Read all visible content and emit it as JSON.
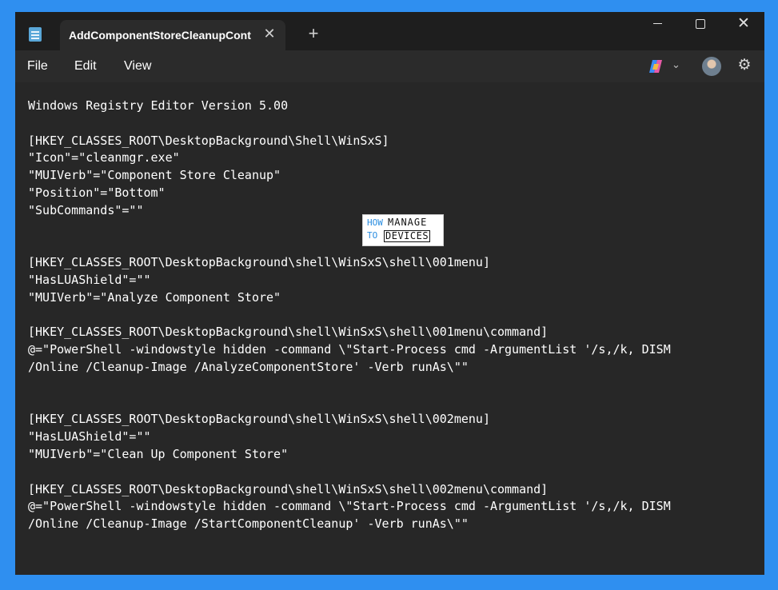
{
  "window": {
    "tab_title": "AddComponentStoreCleanupCont",
    "tab_close_glyph": "✕",
    "new_tab_glyph": "+",
    "close_glyph": "✕"
  },
  "menu": {
    "file": "File",
    "edit": "Edit",
    "view": "View"
  },
  "icons": {
    "app": "notepad-icon",
    "copilot": "copilot-icon",
    "chevron": "chevron-down-icon",
    "settings": "gear-icon"
  },
  "watermark": {
    "how": "HOW",
    "to": "TO",
    "manage": "MANAGE",
    "devices": "DEVICES"
  },
  "editor": {
    "lines": [
      "Windows Registry Editor Version 5.00",
      "",
      "[HKEY_CLASSES_ROOT\\DesktopBackground\\Shell\\WinSxS]",
      "\"Icon\"=\"cleanmgr.exe\"",
      "\"MUIVerb\"=\"Component Store Cleanup\"",
      "\"Position\"=\"Bottom\"",
      "\"SubCommands\"=\"\"",
      "",
      "",
      "[HKEY_CLASSES_ROOT\\DesktopBackground\\shell\\WinSxS\\shell\\001menu]",
      "\"HasLUAShield\"=\"\"",
      "\"MUIVerb\"=\"Analyze Component Store\"",
      "",
      "[HKEY_CLASSES_ROOT\\DesktopBackground\\shell\\WinSxS\\shell\\001menu\\command]",
      "@=\"PowerShell -windowstyle hidden -command \\\"Start-Process cmd -ArgumentList '/s,/k, DISM",
      "/Online /Cleanup-Image /AnalyzeComponentStore' -Verb runAs\\\"\"",
      "",
      "",
      "[HKEY_CLASSES_ROOT\\DesktopBackground\\shell\\WinSxS\\shell\\002menu]",
      "\"HasLUAShield\"=\"\"",
      "\"MUIVerb\"=\"Clean Up Component Store\"",
      "",
      "[HKEY_CLASSES_ROOT\\DesktopBackground\\shell\\WinSxS\\shell\\002menu\\command]",
      "@=\"PowerShell -windowstyle hidden -command \\\"Start-Process cmd -ArgumentList '/s,/k, DISM",
      "/Online /Cleanup-Image /StartComponentCleanup' -Verb runAs\\\"\""
    ]
  }
}
